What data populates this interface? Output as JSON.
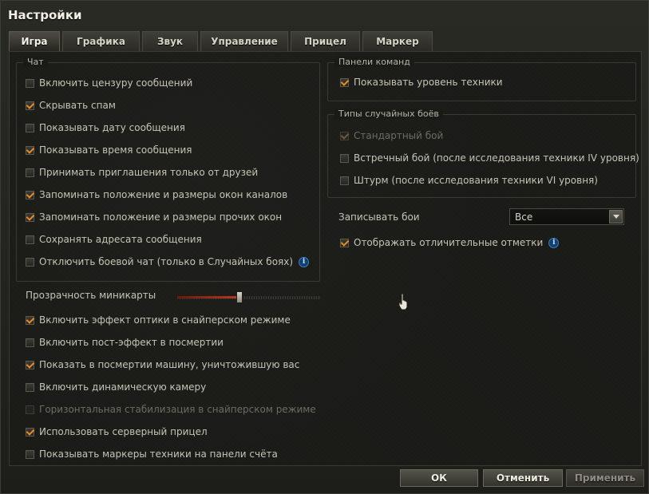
{
  "window": {
    "title": "Настройки"
  },
  "tabs": [
    {
      "label": "Игра",
      "active": true
    },
    {
      "label": "Графика",
      "active": false
    },
    {
      "label": "Звук",
      "active": false
    },
    {
      "label": "Управление",
      "active": false
    },
    {
      "label": "Прицел",
      "active": false
    },
    {
      "label": "Маркер",
      "active": false
    }
  ],
  "chat": {
    "title": "Чат",
    "items": [
      {
        "label": "Включить цензуру сообщений",
        "checked": false
      },
      {
        "label": "Скрывать спам",
        "checked": true
      },
      {
        "label": "Показывать дату сообщения",
        "checked": false
      },
      {
        "label": "Показывать время сообщения",
        "checked": true
      },
      {
        "label": "Принимать приглашения только от друзей",
        "checked": false
      },
      {
        "label": "Запоминать положение и размеры окон каналов",
        "checked": true
      },
      {
        "label": "Запоминать положение и размеры прочих окон",
        "checked": true
      },
      {
        "label": "Сохранять адресата сообщения",
        "checked": false
      },
      {
        "label": "Отключить боевой чат (только в Случайных боях)",
        "checked": false
      }
    ]
  },
  "minimap": {
    "label": "Прозрачность миникарты",
    "value_fraction": 0.43
  },
  "general": {
    "items": [
      {
        "label": "Включить эффект оптики в снайперском режиме",
        "checked": true
      },
      {
        "label": "Включить пост-эффект в посмертии",
        "checked": false
      },
      {
        "label": "Показать в посмертии машину, уничтожившую вас",
        "checked": true
      },
      {
        "label": "Включить динамическую камеру",
        "checked": false
      },
      {
        "label": "Горизонтальная стабилизация в снайперском режиме",
        "checked": false
      },
      {
        "label": "Использовать серверный прицел",
        "checked": true
      },
      {
        "label": "Показывать маркеры техники на панели счёта",
        "checked": false
      }
    ]
  },
  "command_panels": {
    "title": "Панели команд",
    "items": [
      {
        "label": "Показывать уровень техники",
        "checked": true
      }
    ]
  },
  "battle_types": {
    "title": "Типы случайных боёв",
    "items": [
      {
        "label": "Стандартный бой",
        "checked": true
      },
      {
        "label": "Встречный бой (после исследования техники IV уровня)",
        "checked": false
      },
      {
        "label": "Штурм (после исследования техники VI уровня)",
        "checked": false
      }
    ]
  },
  "record": {
    "label": "Записывать бои",
    "selected": "Все"
  },
  "marks": {
    "label": "Отображать отличительные отметки",
    "checked": true
  },
  "info_icon_glyph": "i",
  "buttons": {
    "ok": "ОК",
    "cancel": "Отменить",
    "apply": "Применить"
  },
  "colors": {
    "accent": "#e68b2a",
    "info": "#3c7cc4",
    "slider_fill": "#b53a22"
  }
}
